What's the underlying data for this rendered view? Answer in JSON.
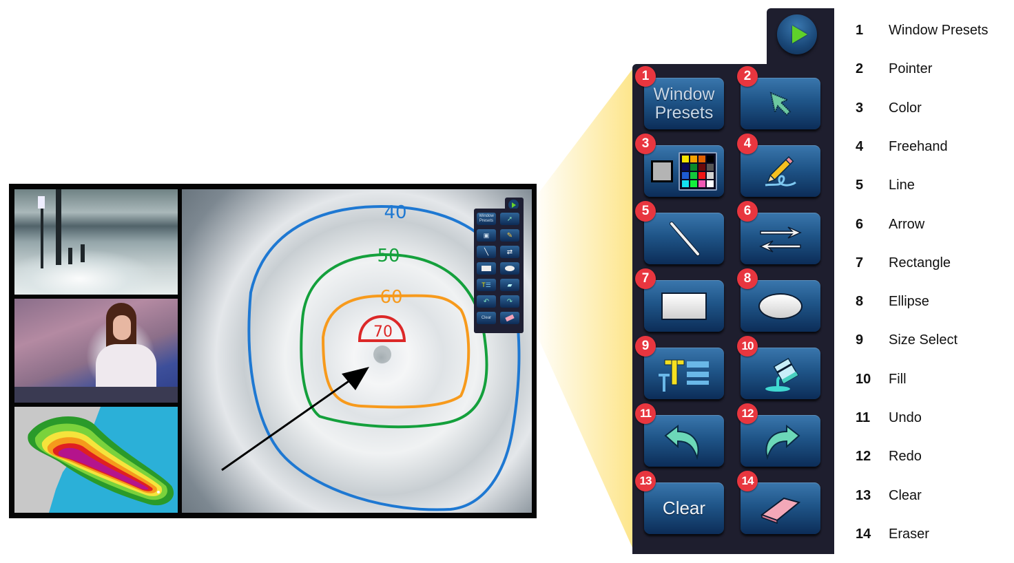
{
  "storm_annotations": {
    "contours": [
      {
        "label": "40",
        "color": "#1e78d2"
      },
      {
        "label": "50",
        "color": "#14a03c"
      },
      {
        "label": "60",
        "color": "#f79a1c"
      },
      {
        "label": "70",
        "color": "#dc2828"
      }
    ],
    "arrow_color": "#000000"
  },
  "mini_toolbar": {
    "window_presets": "Window Presets",
    "clear": "Clear"
  },
  "toolbar": {
    "play_button": "play",
    "buttons": [
      {
        "number": "1",
        "label": "Window Presets",
        "icon": "text-window-presets"
      },
      {
        "number": "2",
        "label": "Pointer",
        "icon": "pointer-arrow-icon"
      },
      {
        "number": "3",
        "label": "Color",
        "icon": "color-palette-icon"
      },
      {
        "number": "4",
        "label": "Freehand",
        "icon": "pencil-icon"
      },
      {
        "number": "5",
        "label": "Line",
        "icon": "line-icon"
      },
      {
        "number": "6",
        "label": "Arrow",
        "icon": "double-arrow-icon"
      },
      {
        "number": "7",
        "label": "Rectangle",
        "icon": "rectangle-icon"
      },
      {
        "number": "8",
        "label": "Ellipse",
        "icon": "ellipse-icon"
      },
      {
        "number": "9",
        "label": "Size Select",
        "icon": "size-select-icon"
      },
      {
        "number": "10",
        "label": "Fill",
        "icon": "paint-bucket-icon"
      },
      {
        "number": "11",
        "label": "Undo",
        "icon": "undo-icon"
      },
      {
        "number": "12",
        "label": "Redo",
        "icon": "redo-icon"
      },
      {
        "number": "13",
        "label": "Clear",
        "icon": "text-clear"
      },
      {
        "number": "14",
        "label": "Eraser",
        "icon": "eraser-icon"
      }
    ],
    "button_text": {
      "window_presets_line1": "Window",
      "window_presets_line2": "Presets",
      "clear": "Clear"
    },
    "palette_colors": [
      "#f5e400",
      "#f5a300",
      "#e06000",
      "#000000",
      "#0a0a5a",
      "#0a8a2a",
      "#6a0a0a",
      "#555555",
      "#1e5ad2",
      "#14c83c",
      "#f01414",
      "#d2d2d2",
      "#14e0f0",
      "#14f03c",
      "#f05ab4",
      "#ffffff"
    ]
  },
  "legend": [
    {
      "number": "1",
      "label": "Window Presets"
    },
    {
      "number": "2",
      "label": "Pointer"
    },
    {
      "number": "3",
      "label": "Color"
    },
    {
      "number": "4",
      "label": "Freehand"
    },
    {
      "number": "5",
      "label": "Line"
    },
    {
      "number": "6",
      "label": "Arrow"
    },
    {
      "number": "7",
      "label": "Rectangle"
    },
    {
      "number": "8",
      "label": "Ellipse"
    },
    {
      "number": "9",
      "label": "Size Select"
    },
    {
      "number": "10",
      "label": "Fill"
    },
    {
      "number": "11",
      "label": "Undo"
    },
    {
      "number": "12",
      "label": "Redo"
    },
    {
      "number": "13",
      "label": "Clear"
    },
    {
      "number": "14",
      "label": "Eraser"
    }
  ],
  "colors": {
    "panel_bg": "#1e1e2e",
    "button_top": "#3a77ad",
    "button_bottom": "#0c2d58",
    "badge": "#e8363f",
    "play_triangle": "#5fd12a",
    "callout_beam": "#fde58a"
  }
}
